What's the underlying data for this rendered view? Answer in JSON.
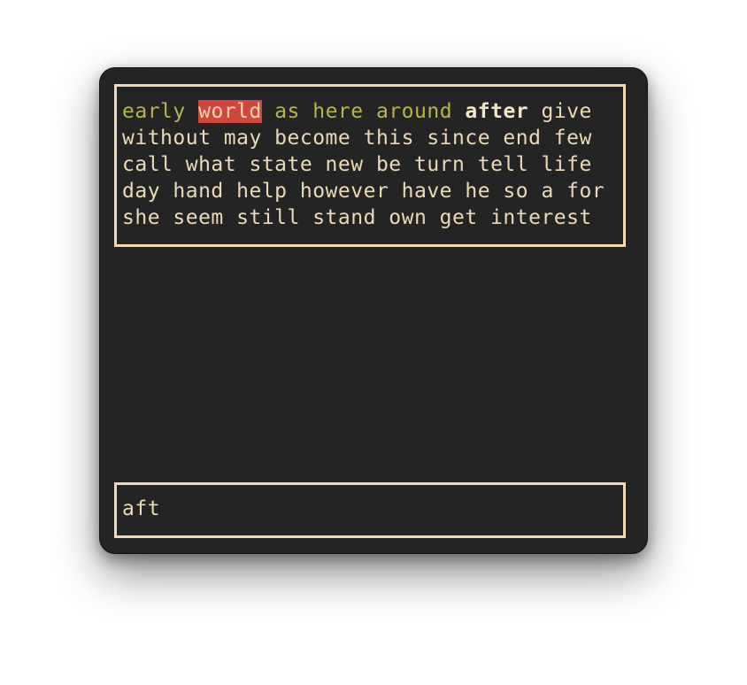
{
  "typing_test": {
    "line1": {
      "typed": "early ",
      "current": "world",
      "typed_after": " as here around ",
      "next": "after",
      "rest": " give"
    },
    "line2": "without may become this since end few",
    "line3": "call what state new be turn tell life",
    "line4": "day hand help however have he so a for",
    "line5": "she seem still stand own get interest"
  },
  "input": {
    "value": "aft"
  },
  "colors": {
    "background": "#242424",
    "border": "#f0d9b0",
    "text": "#ecd9b5",
    "typed": "#b6b54a",
    "current_highlight": "#d2473c"
  }
}
